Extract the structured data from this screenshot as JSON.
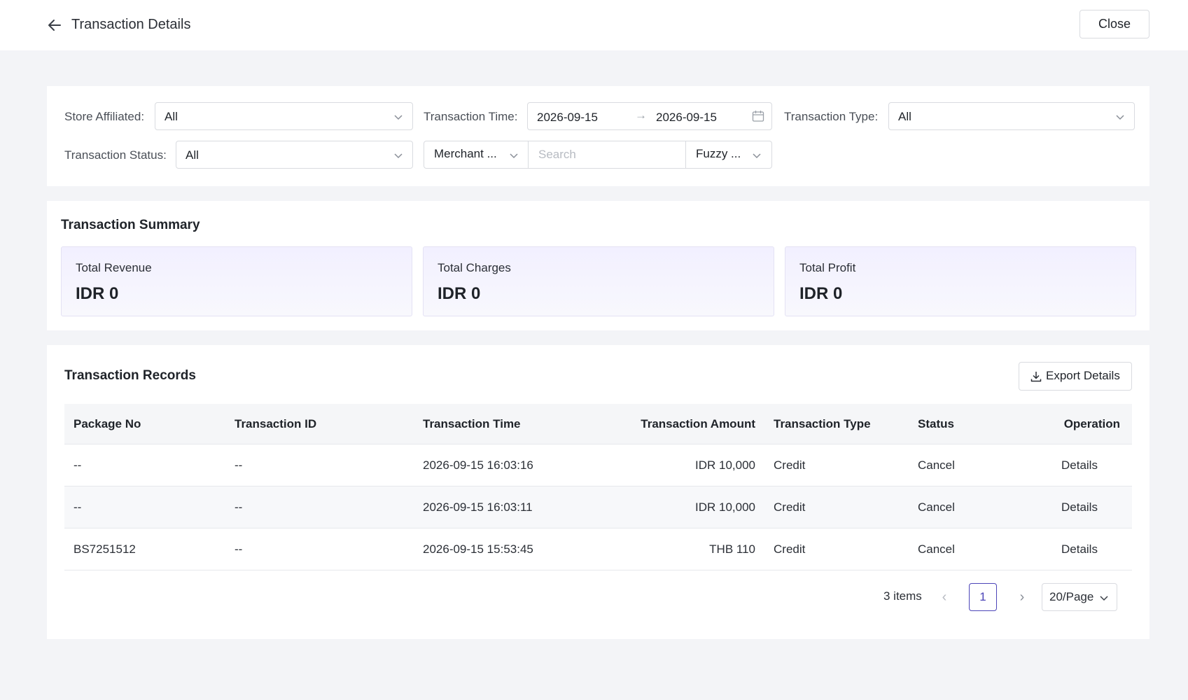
{
  "header": {
    "title": "Transaction Details",
    "close_label": "Close"
  },
  "filters": {
    "store_label": "Store Affiliated:",
    "store_value": "All",
    "time_label": "Transaction Time:",
    "time_start": "2026-09-15",
    "time_arrow": "→",
    "time_end": "2026-09-15",
    "type_label": "Transaction Type:",
    "type_value": "All",
    "status_label": "Transaction Status:",
    "status_value": "All",
    "field_select": "Merchant ...",
    "search_placeholder": "Search",
    "match_select": "Fuzzy ..."
  },
  "summary": {
    "title": "Transaction Summary",
    "cards": [
      {
        "label": "Total Revenue",
        "value": "IDR 0"
      },
      {
        "label": "Total Charges",
        "value": "IDR 0"
      },
      {
        "label": "Total Profit",
        "value": "IDR 0"
      }
    ]
  },
  "records": {
    "title": "Transaction Records",
    "export_label": "Export Details",
    "columns": [
      "Package No",
      "Transaction ID",
      "Transaction Time",
      "Transaction Amount",
      "Transaction Type",
      "Status",
      "Operation"
    ],
    "rows": [
      {
        "package_no": "--",
        "transaction_id": "--",
        "time": "2026-09-15 16:03:16",
        "amount": "IDR 10,000",
        "type": "Credit",
        "status": "Cancel",
        "operation": "Details"
      },
      {
        "package_no": "--",
        "transaction_id": "--",
        "time": "2026-09-15 16:03:11",
        "amount": "IDR 10,000",
        "type": "Credit",
        "status": "Cancel",
        "operation": "Details"
      },
      {
        "package_no": "BS7251512",
        "transaction_id": "--",
        "time": "2026-09-15 15:53:45",
        "amount": "THB 110",
        "type": "Credit",
        "status": "Cancel",
        "operation": "Details"
      }
    ],
    "pagination": {
      "total": "3 items",
      "current_page": "1",
      "page_size": "20/Page",
      "prev": "‹",
      "next": "›"
    }
  },
  "icons": {
    "back": "arrow-left-icon",
    "calendar": "calendar-icon",
    "download": "download-icon",
    "chevron": "chevron-down-icon"
  },
  "colors": {
    "accent": "#4c45b8",
    "background": "#f3f4f7",
    "card_tint": "#f2f0ff"
  }
}
